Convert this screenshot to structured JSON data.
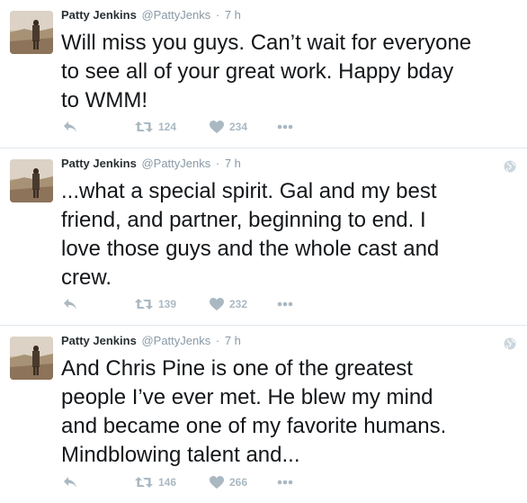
{
  "colors": {
    "accent": "#aab8c2",
    "meta": "#8899a6",
    "text": "#14171a",
    "divider": "#e1e8ed"
  },
  "icons": {
    "reply": "reply-icon",
    "retweet": "retweet-icon",
    "like": "heart-icon",
    "more": "more-icon",
    "globe": "globe-icon"
  },
  "tweets": [
    {
      "name": "Patty Jenkins",
      "handle": "@PattyJenks",
      "separator": "·",
      "time": "7 h",
      "text": "Will miss you guys. Can’t wait for everyone\nto see all of your great work. Happy bday\nto WMM!",
      "retweets": "124",
      "likes": "234"
    },
    {
      "name": "Patty Jenkins",
      "handle": "@PattyJenks",
      "separator": "·",
      "time": "7 h",
      "text": "...what a special spirit. Gal and my best\nfriend, and partner, beginning to end.  I\nlove those guys and the whole cast and\ncrew.",
      "retweets": "139",
      "likes": "232"
    },
    {
      "name": "Patty Jenkins",
      "handle": "@PattyJenks",
      "separator": "·",
      "time": "7 h",
      "text": "And Chris Pine is one of the greatest\npeople I’ve ever met. He blew my mind\nand became one of my favorite humans.\nMindblowing talent and...",
      "retweets": "146",
      "likes": "266"
    }
  ]
}
